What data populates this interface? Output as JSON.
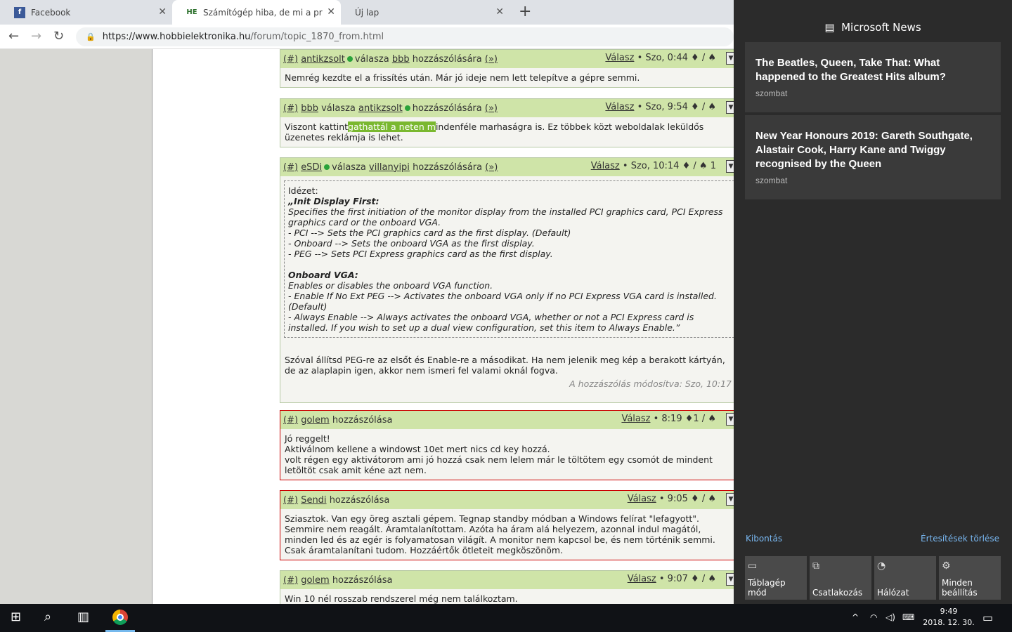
{
  "browser": {
    "tabs": [
      {
        "label": "Facebook",
        "icon": "facebook-icon"
      },
      {
        "label": "Számítógép hiba, de mi a problé",
        "icon": "hobbielektronika-icon",
        "fav": "HE"
      },
      {
        "label": "Új lap"
      }
    ],
    "url_host": "https://www.hobbielektronika.hu",
    "url_path": "/forum/topic_1870_from.html"
  },
  "posts": [
    {
      "num": "(#)",
      "author": "antikzsolt",
      "mid": "válasza",
      "target": "bbb",
      "tail": "hozzászólására",
      "more": "(»)",
      "reply": "Válasz",
      "time": "• Szo, 0:44",
      "votes": "/",
      "body": "Nemrég kezdte el a frissítés után. Már jó ideje nem lett telepítve a gépre semmi."
    },
    {
      "num": "(#)",
      "author": "bbb",
      "mid": "válasza",
      "target": "antikzsolt",
      "tail": "hozzászólására",
      "more": "(»)",
      "reply": "Válasz",
      "time": "• Szo, 9:54",
      "votes": "/",
      "body_a": "Viszont kattint",
      "body_hl": "gathattál a neten m",
      "body_b": "indenféle marhaságra is. Ez többek közt weboldalak leküldős üzenetes reklámja is lehet."
    },
    {
      "num": "(#)",
      "author": "eSDi",
      "mid": "válasza",
      "target": "villanyipi",
      "tail": "hozzászólására",
      "more": "(»)",
      "reply": "Válasz",
      "time": "• Szo, 10:14",
      "votes": "/",
      "likes": "1",
      "quote_label": "Idézet:",
      "quote_lines": [
        "„Init Display First:",
        "Specifies the first initiation of the monitor display from the installed PCI graphics card, PCI Express graphics card or the onboard VGA.",
        "- PCI --> Sets the PCI graphics card as the first display. (Default)",
        "- Onboard --> Sets the onboard VGA as the first display.",
        "- PEG --> Sets PCI Express graphics card as the first display.",
        "Onboard VGA:",
        "Enables or disables the onboard VGA function.",
        "- Enable If No Ext PEG --> Activates the onboard VGA only if no PCI Express VGA card is installed. (Default)",
        "- Always Enable --> Always activates the onboard VGA, whether or not a PCI Express card is installed. If you wish to set up a dual view configuration, set this item to Always Enable.”"
      ],
      "body": "Szóval állítsd PEG-re az elsőt és Enable-re a másodikat. Ha nem jelenik meg kép a berakott kártyán, de az alaplapin igen, akkor nem ismeri fel valami oknál fogva.",
      "modnote": "A hozzászólás módosítva: Szo, 10:17"
    },
    {
      "num": "(#)",
      "author": "golem",
      "tail": "hozzászólása",
      "reply": "Válasz",
      "time": "• 8:19",
      "votes": "1 /",
      "lines": [
        "Jó reggelt!",
        "Aktiválnom kellene a windowst 10et mert nics cd key hozzá.",
        "volt régen egy aktivátorom ami jó hozzá csak nem lelem már le töltötem egy csomót de mindent letöltöt csak amit kéne azt nem."
      ]
    },
    {
      "num": "(#)",
      "author": "Sendi",
      "tail": "hozzászólása",
      "reply": "Válasz",
      "time": "• 9:05",
      "votes": "/",
      "body": "Sziasztok. Van egy öreg asztali gépem. Tegnap standby módban a Windows felírat \"lefagyott\". Semmire nem reagált. Áramtalanítottam. Azóta ha áram alá helyezem, azonnal indul magától, minden led és az egér is folyamatosan világít. A monitor nem kapcsol be, és nem történik semmi. Csak áramtalanítani tudom. Hozzáértők ötleteit megköszönöm."
    },
    {
      "num": "(#)",
      "author": "golem",
      "tail": "hozzászólása",
      "reply": "Válasz",
      "time": "• 9:07",
      "votes": "/",
      "body": "Win 10 nél rosszab rendszerel még nem találkoztam."
    }
  ],
  "news": {
    "title": "Microsoft News",
    "cards": [
      {
        "headline": "The Beatles, Queen, Take That: What happened to the Greatest Hits album?",
        "time": "szombat"
      },
      {
        "headline": "New Year Honours 2019: Gareth Southgate, Alastair Cook, Harry Kane and Twiggy recognised by the Queen",
        "time": "szombat"
      }
    ],
    "expand": "Kibontás",
    "clear": "Értesítések törlése",
    "actions": [
      {
        "label": "Táblagép mód",
        "icon": "tablet-mode-icon"
      },
      {
        "label": "Csatlakozás",
        "icon": "connect-icon"
      },
      {
        "label": "Hálózat",
        "icon": "network-icon"
      },
      {
        "label": "Minden beállítás",
        "icon": "settings-icon"
      }
    ]
  },
  "taskbar": {
    "time": "9:49",
    "date": "2018. 12. 30."
  }
}
